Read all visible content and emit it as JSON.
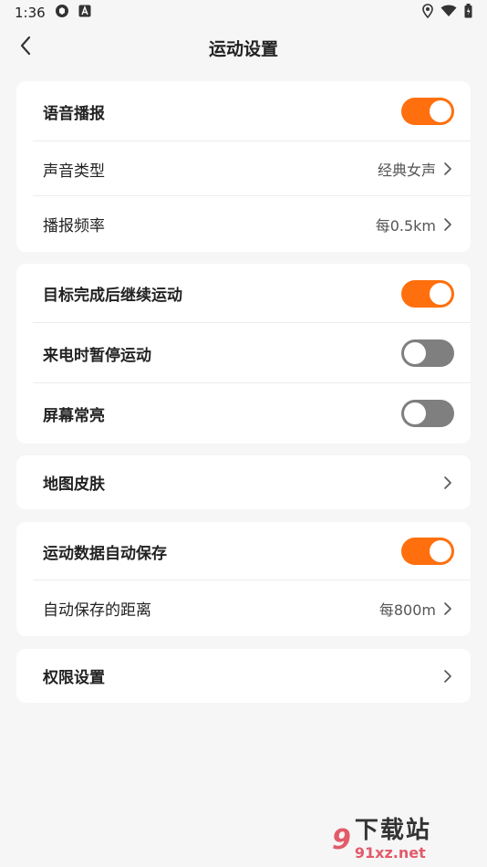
{
  "status_bar": {
    "time": "1:36",
    "icons": [
      "vpn-icon",
      "text-a-icon",
      "location-icon",
      "wifi-icon",
      "battery-icon"
    ]
  },
  "header": {
    "title": "运动设置",
    "back_icon": "chevron-left-icon"
  },
  "cards": [
    {
      "rows": [
        {
          "label": "语音播报",
          "type": "toggle",
          "on": true
        },
        {
          "label": "声音类型",
          "type": "value",
          "value": "经典女声"
        },
        {
          "label": "播报频率",
          "type": "value",
          "value": "每0.5km"
        }
      ]
    },
    {
      "rows": [
        {
          "label": "目标完成后继续运动",
          "type": "toggle",
          "on": true
        },
        {
          "label": "来电时暂停运动",
          "type": "toggle",
          "on": false
        },
        {
          "label": "屏幕常亮",
          "type": "toggle",
          "on": false
        }
      ]
    },
    {
      "rows": [
        {
          "label": "地图皮肤",
          "type": "chevron"
        }
      ]
    },
    {
      "rows": [
        {
          "label": "运动数据自动保存",
          "type": "toggle",
          "on": true
        },
        {
          "label": "自动保存的距离",
          "type": "value",
          "value": "每800m"
        }
      ]
    },
    {
      "rows": [
        {
          "label": "权限设置",
          "type": "chevron"
        }
      ]
    }
  ],
  "watermark": {
    "logo": "9",
    "title": "下载站",
    "url": "91xz.net"
  },
  "colors": {
    "accent": "#ff6f0e",
    "toggle_off": "#7f7f7f",
    "background": "#f6f6f6",
    "card": "#ffffff"
  }
}
